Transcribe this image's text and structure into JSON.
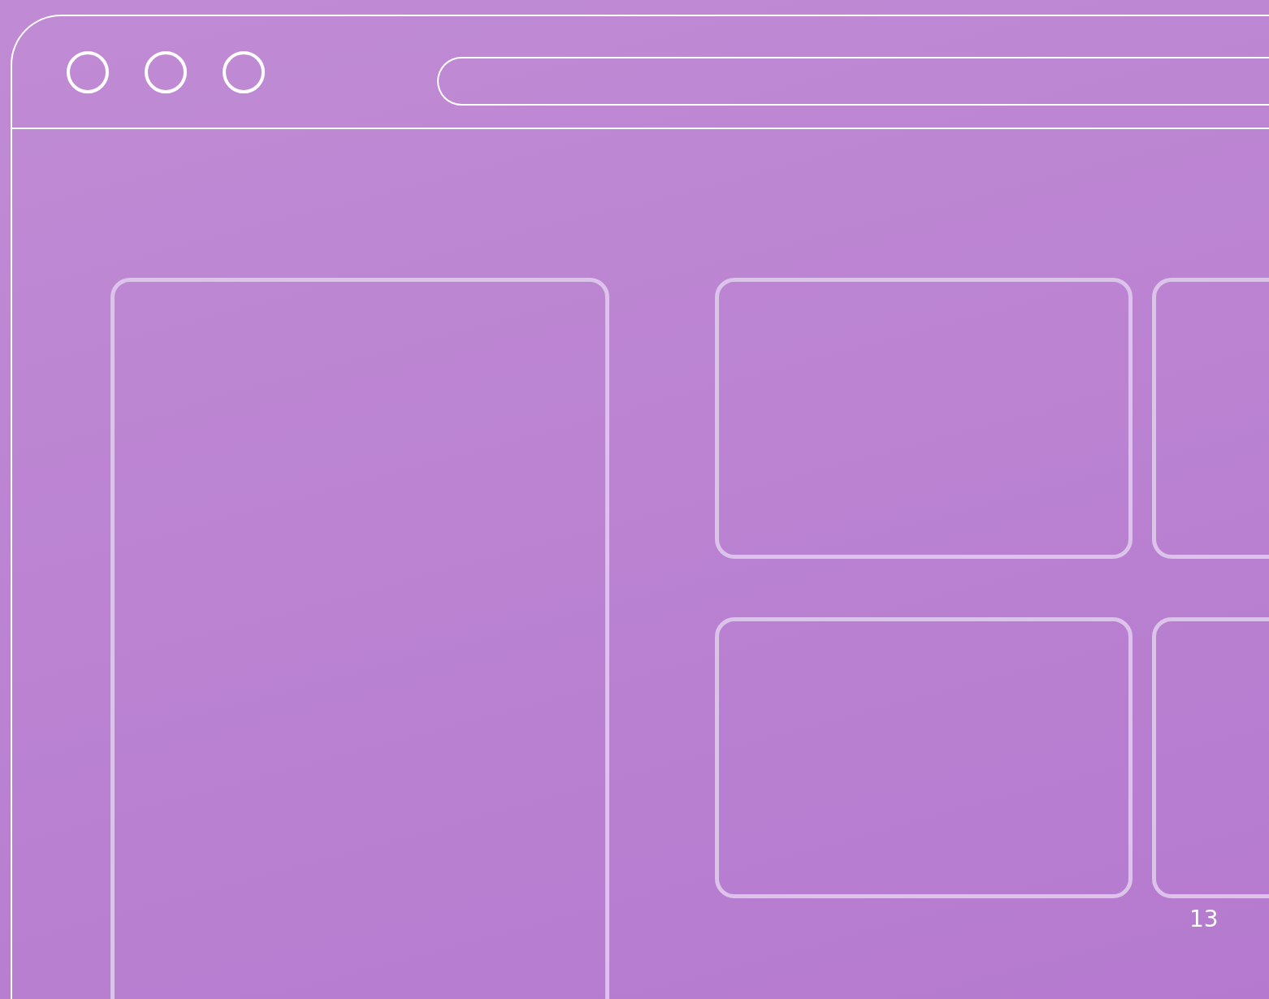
{
  "page_number": "13"
}
